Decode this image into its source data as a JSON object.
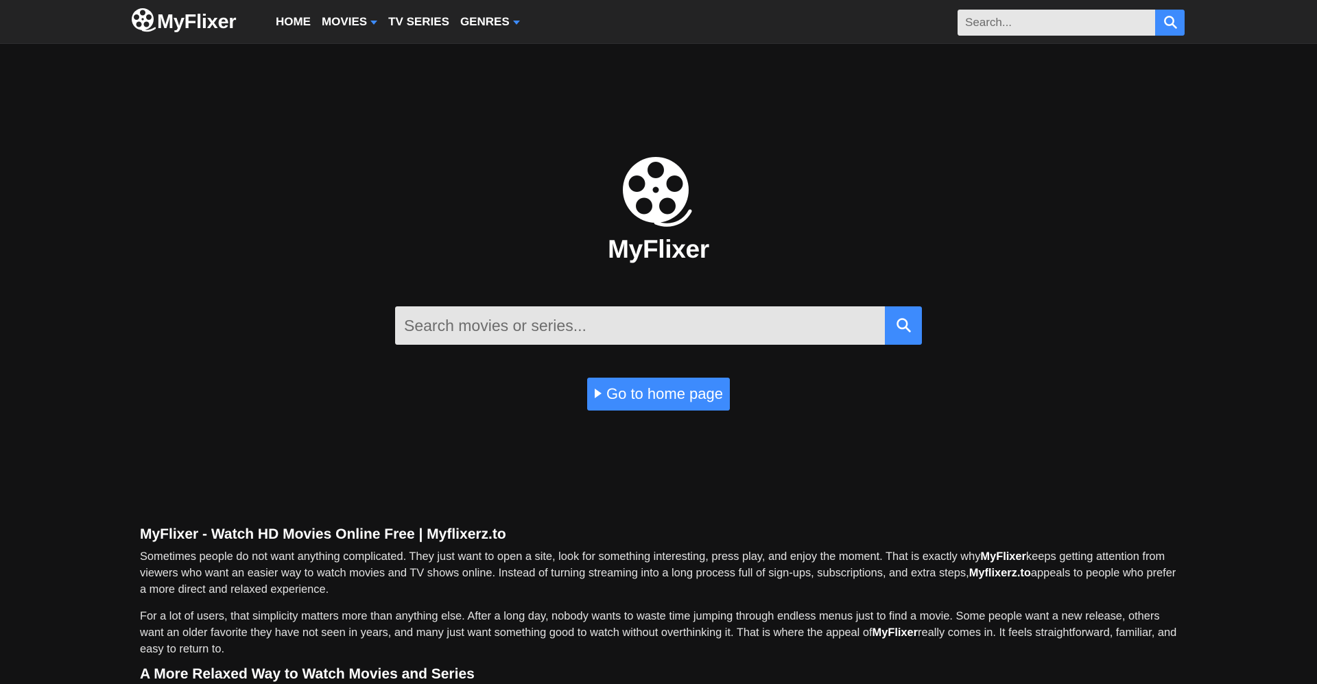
{
  "brand": {
    "name": "MyFlixer",
    "logo_icon": "film-reel-icon"
  },
  "nav": {
    "items": [
      {
        "label": "HOME",
        "dropdown": false
      },
      {
        "label": "MOVIES",
        "dropdown": true
      },
      {
        "label": "TV SERIES",
        "dropdown": false
      },
      {
        "label": "GENRES",
        "dropdown": true
      }
    ]
  },
  "top_search": {
    "placeholder": "Search...",
    "icon": "search-icon"
  },
  "hero": {
    "name": "MyFlixer",
    "search_placeholder": "Search movies or series...",
    "home_button": "Go to home page",
    "home_icon": "play-icon"
  },
  "article": {
    "title": "MyFlixer - Watch HD Movies Online Free | Myflixerz.to",
    "p1": {
      "a": "Sometimes people do not want anything complicated. They just want to open a site, look for something interesting, press play, and enjoy the moment. That is exactly why",
      "b1": "MyFlixer",
      "c": "keeps getting attention from viewers who want an easier way to watch movies and TV shows online. Instead of turning streaming into a long process full of sign-ups, subscriptions, and extra steps,",
      "b2": "Myflixerz.to",
      "d": "appeals to people who prefer a more direct and relaxed experience."
    },
    "p2": {
      "a": "For a lot of users, that simplicity matters more than anything else. After a long day, nobody wants to waste time jumping through endless menus just to find a movie. Some people want a new release, others want an older favorite they have not seen in years, and many just want something good to watch without overthinking it. That is where the appeal of",
      "b1": "MyFlixer",
      "c": "really comes in. It feels straightforward, familiar, and easy to return to."
    },
    "subtitle": "A More Relaxed Way to Watch Movies and Series"
  },
  "colors": {
    "accent": "#3d8bfd",
    "navbar_bg": "#232324",
    "page_bg": "#121213"
  }
}
